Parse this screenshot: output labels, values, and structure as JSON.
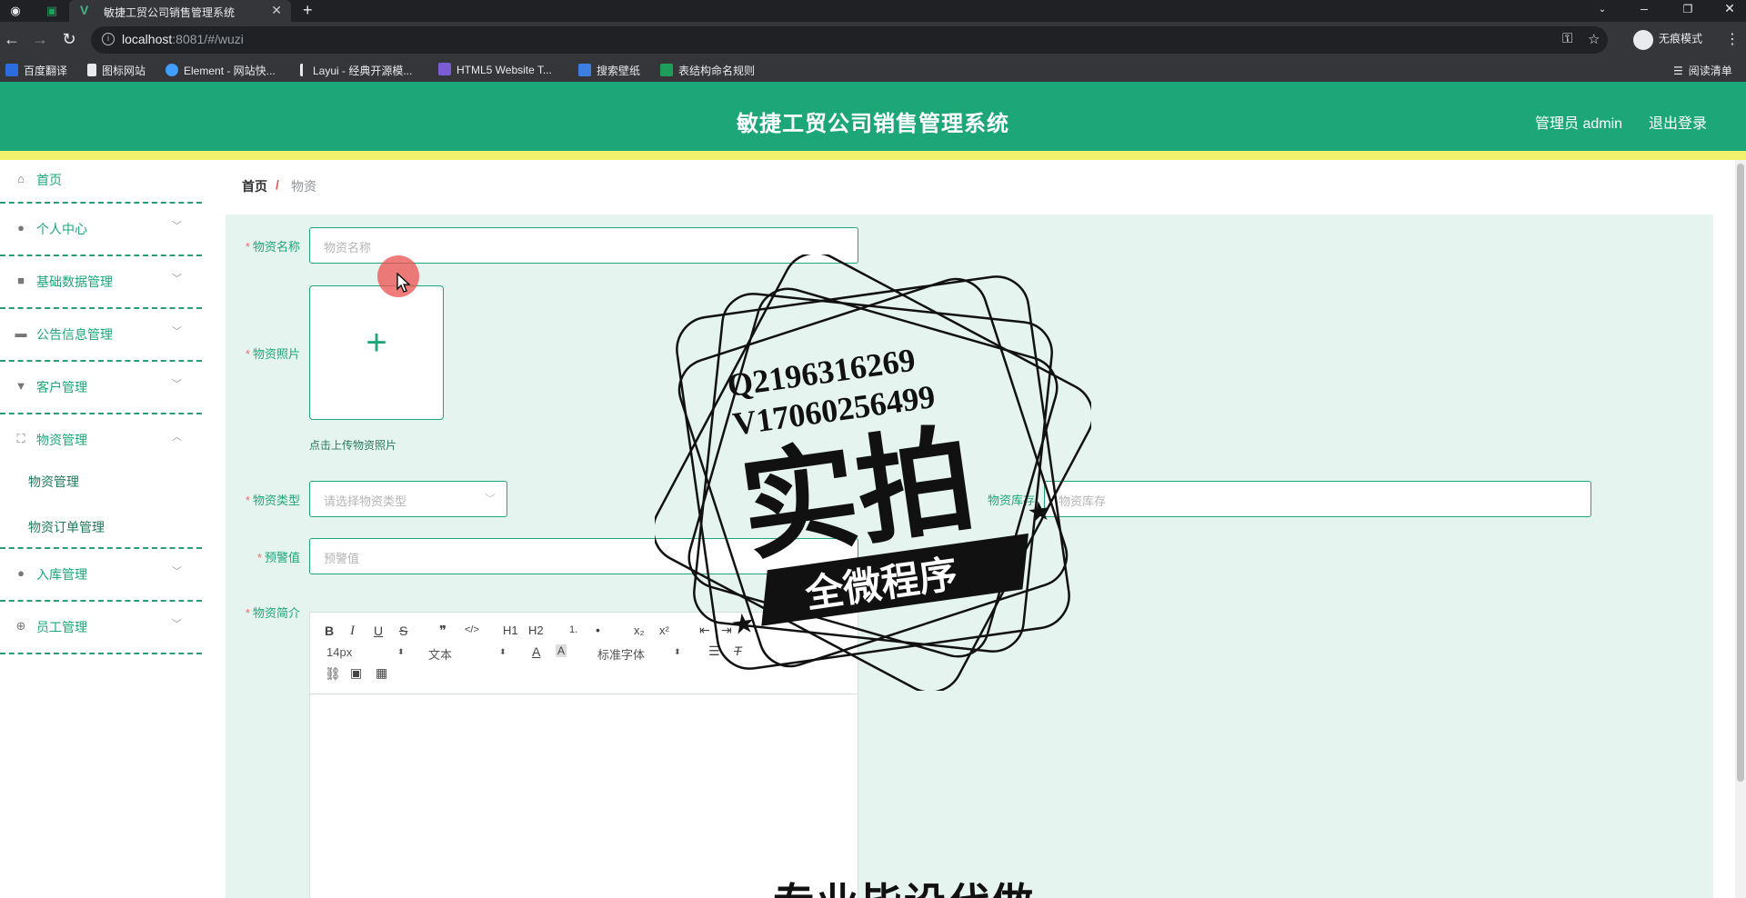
{
  "browser": {
    "tab_title": "敏捷工贸公司销售管理系统",
    "url_host": "localhost",
    "url_path": ":8081/#/wuzi",
    "incognito_label": "无痕模式",
    "reading_list": "阅读清单",
    "bookmarks": [
      {
        "label": "百度翻译",
        "icon": "baidu-translate-icon",
        "color": "#2d6cdf"
      },
      {
        "label": "图标网站",
        "icon": "flag-icon",
        "color": "#e8eaed"
      },
      {
        "label": "Element - 网站快...",
        "icon": "element-icon",
        "color": "#409eff"
      },
      {
        "label": "Layui - 经典开源模...",
        "icon": "layui-icon",
        "color": "#e8eaed"
      },
      {
        "label": "HTML5 Website T...",
        "icon": "html5-icon",
        "color": "#7c5cd6"
      },
      {
        "label": "搜索壁纸",
        "icon": "wallpaper-icon",
        "color": "#3d7fe0"
      },
      {
        "label": "表结构命名规则",
        "icon": "sheet-icon",
        "color": "#1e9e5b"
      }
    ]
  },
  "app": {
    "title": "敏捷工贸公司销售管理系统",
    "user": "管理员 admin",
    "logout": "退出登录",
    "accent": "#1da779",
    "stripe": "#f1f16b"
  },
  "sidebar": {
    "items": [
      {
        "label": "首页",
        "icon": "home-icon",
        "expandable": false
      },
      {
        "label": "个人中心",
        "icon": "user-icon",
        "expandable": true
      },
      {
        "label": "基础数据管理",
        "icon": "data-icon",
        "expandable": true
      },
      {
        "label": "公告信息管理",
        "icon": "notice-icon",
        "expandable": true
      },
      {
        "label": "客户管理",
        "icon": "customer-icon",
        "expandable": true
      },
      {
        "label": "物资管理",
        "icon": "goods-icon",
        "expandable": true,
        "open": true
      },
      {
        "label": "入库管理",
        "icon": "stock-in-icon",
        "expandable": true
      },
      {
        "label": "员工管理",
        "icon": "staff-icon",
        "expandable": true
      }
    ],
    "sub_items": [
      "物资管理",
      "物资订单管理"
    ]
  },
  "breadcrumb": {
    "home": "首页",
    "separator": "/",
    "current": "物资"
  },
  "form": {
    "name": {
      "label": "物资名称",
      "placeholder": "物资名称"
    },
    "photo": {
      "label": "物资照片",
      "tip": "点击上传物资照片"
    },
    "type": {
      "label": "物资类型",
      "placeholder": "请选择物资类型"
    },
    "stock": {
      "label": "物资库存",
      "placeholder": "物资库存"
    },
    "warn": {
      "label": "预警值",
      "placeholder": "预警值"
    },
    "intro": {
      "label": "物资简介"
    }
  },
  "editor": {
    "font_size": "14px",
    "text_style": "文本",
    "font_family": "标准字体",
    "buttons": [
      "B",
      "I",
      "U",
      "S",
      "❞",
      "</>",
      "H1",
      "H2",
      "1.",
      "•",
      "x₂",
      "x²"
    ]
  },
  "watermark": {
    "line1": "Q2196316269",
    "line2": "V17060256499",
    "big": "实拍",
    "banner": "全微程序",
    "bottom": "专业毕设代做"
  }
}
